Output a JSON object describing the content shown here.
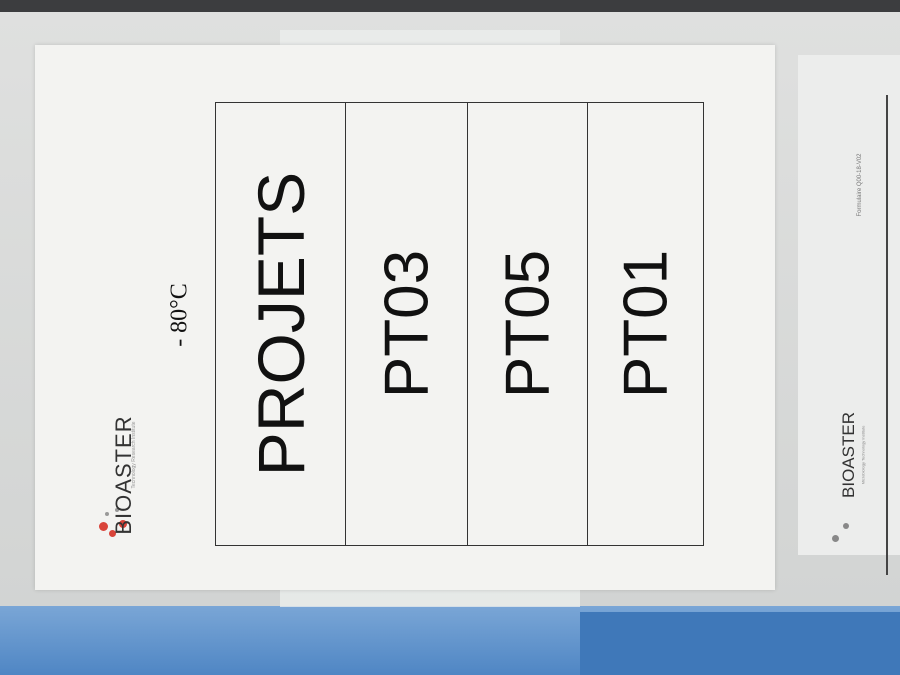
{
  "label": {
    "temperature": "- 80°C",
    "header": "PROJETS",
    "projects": [
      "PT03",
      "PT05",
      "PT01"
    ],
    "logo_text": "BIOASTER",
    "logo_tagline": "Technology Research Institute"
  },
  "second_sheet": {
    "form_ref": "Formulaire Q00-18-V02",
    "logo_text": "BIOASTER",
    "logo_tagline": "Microbiology Technology Institute"
  },
  "colors": {
    "logo_dots": "#d9443a",
    "freezer_blue": "#4f86c4"
  }
}
